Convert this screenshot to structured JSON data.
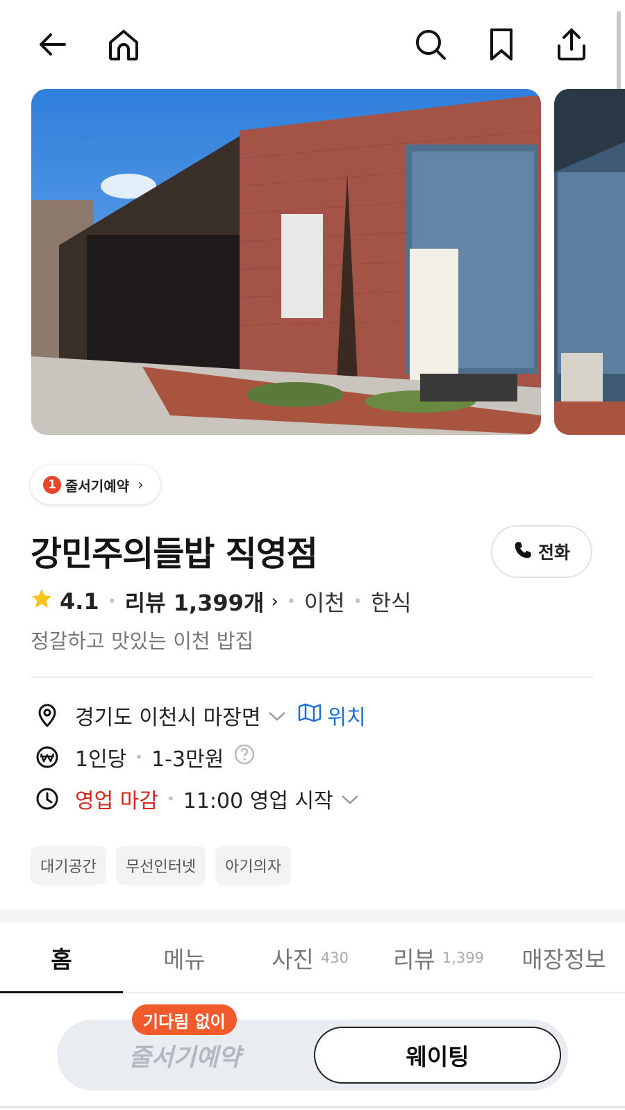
{
  "topbar": {
    "icons": [
      "back-arrow-icon",
      "home-icon",
      "search-icon",
      "bookmark-icon",
      "share-icon"
    ]
  },
  "waitlist_chip": {
    "number": "1",
    "label": "줄서기예약"
  },
  "place": {
    "name": "강민주의들밥 직영점",
    "call_label": "전화",
    "rating": "4.1",
    "reviews_label": "리뷰 1,399개",
    "region": "이천",
    "category": "한식",
    "description": "정갈하고 맛있는 이천 밥집"
  },
  "info": {
    "address": "경기도 이천시 마장면",
    "map_label": "위치",
    "price_prefix": "1인당",
    "price_range": "1-3만원",
    "status": "영업 마감",
    "open_time": "11:00 영업 시작"
  },
  "tags": [
    "대기공간",
    "무선인터넷",
    "아기의자"
  ],
  "tabs": [
    {
      "label": "홈",
      "count": ""
    },
    {
      "label": "메뉴",
      "count": ""
    },
    {
      "label": "사진",
      "count": "430"
    },
    {
      "label": "리뷰",
      "count": "1,399"
    },
    {
      "label": "매장정보",
      "count": ""
    }
  ],
  "cta": {
    "badge": "기다림 없이",
    "left_label": "줄서기예약",
    "right_label": "웨이팅"
  },
  "colors": {
    "accent_red": "#d3261d",
    "link_blue": "#1d6fd8",
    "badge_orange": "#f15a2b",
    "star_yellow": "#f5c518"
  }
}
